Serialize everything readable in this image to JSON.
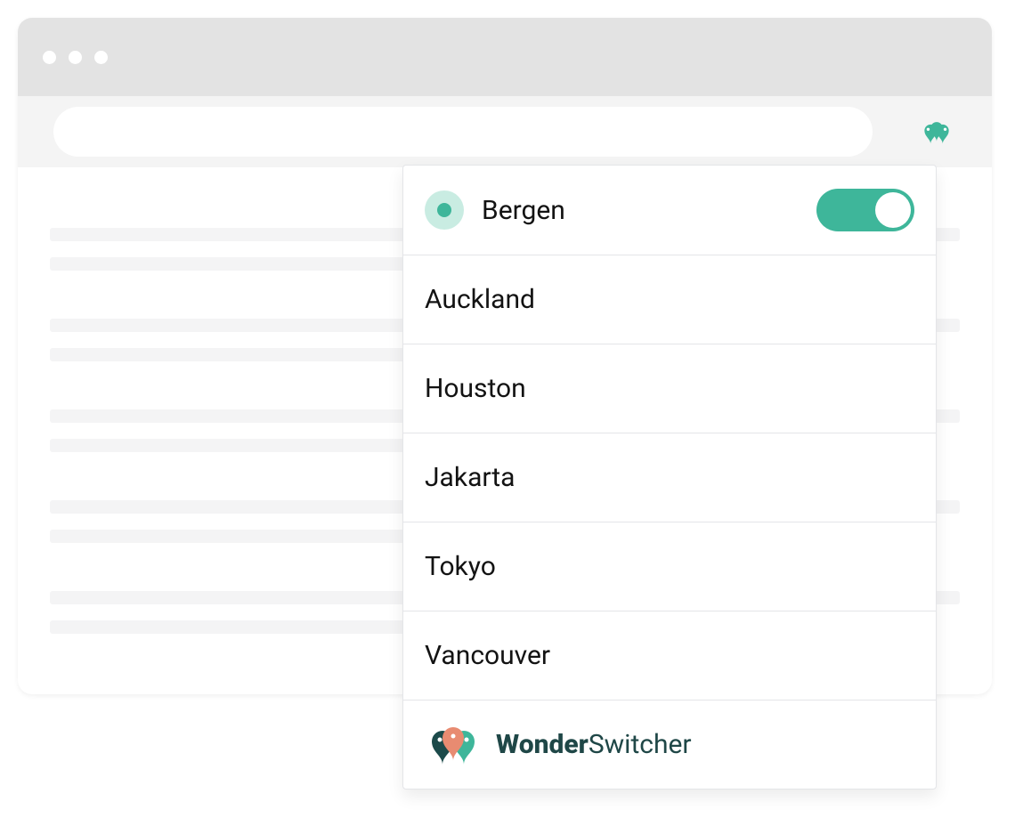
{
  "brand": {
    "name_bold": "Wonder",
    "name_rest": "Switcher",
    "accent_color": "#3eb69a",
    "dark_color": "#1c4a4a"
  },
  "panel": {
    "active_location": "Bergen",
    "toggle_on": true,
    "items": [
      {
        "label": "Auckland"
      },
      {
        "label": "Houston"
      },
      {
        "label": "Jakarta"
      },
      {
        "label": "Tokyo"
      },
      {
        "label": "Vancouver"
      }
    ]
  }
}
